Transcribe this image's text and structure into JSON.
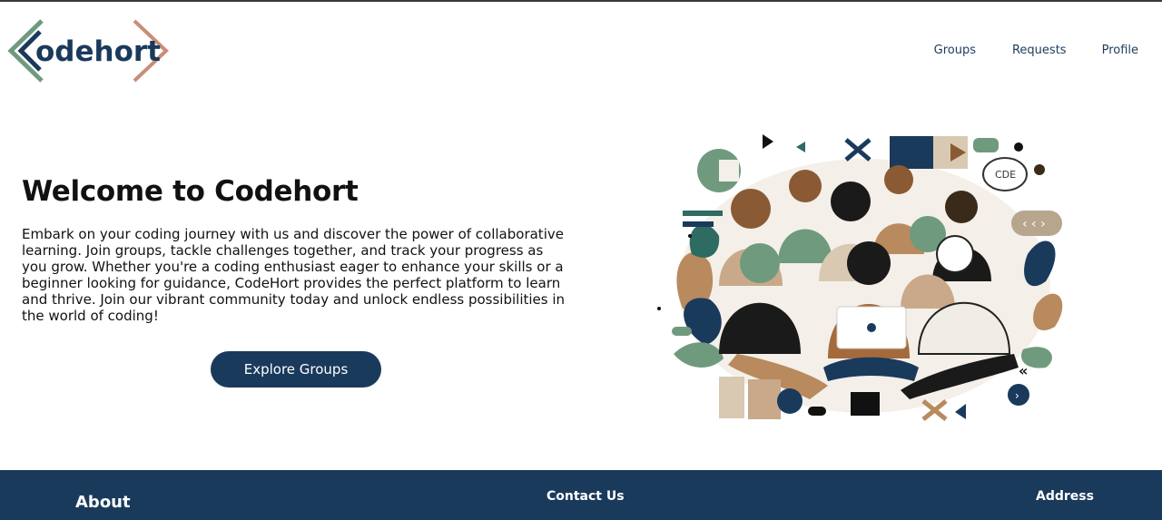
{
  "brand": {
    "logo_text": "odehort",
    "accent_green": "#6f9a7e",
    "accent_navy": "#1a3a5c",
    "accent_copper": "#c98d78"
  },
  "nav": {
    "groups_label": "Groups",
    "requests_label": "Requests",
    "profile_label": "Profile"
  },
  "hero": {
    "title": "Welcome to Codehort",
    "description": "Embark on your coding journey with us and discover the power of collaborative learning. Join groups, tackle challenges together, and track your progress as you grow. Whether you're a coding enthusiast eager to enhance your skills or a beginner looking for guidance, CodeHort provides the perfect platform to learn and thrive. Join our vibrant community today and unlock endless possibilities in the world of coding!",
    "cta_label": "Explore Groups",
    "illustration_badge": "CDE"
  },
  "footer": {
    "about_heading": "About",
    "contact_heading": "Contact Us",
    "address_heading": "Address",
    "background": "#1a3a5c"
  }
}
